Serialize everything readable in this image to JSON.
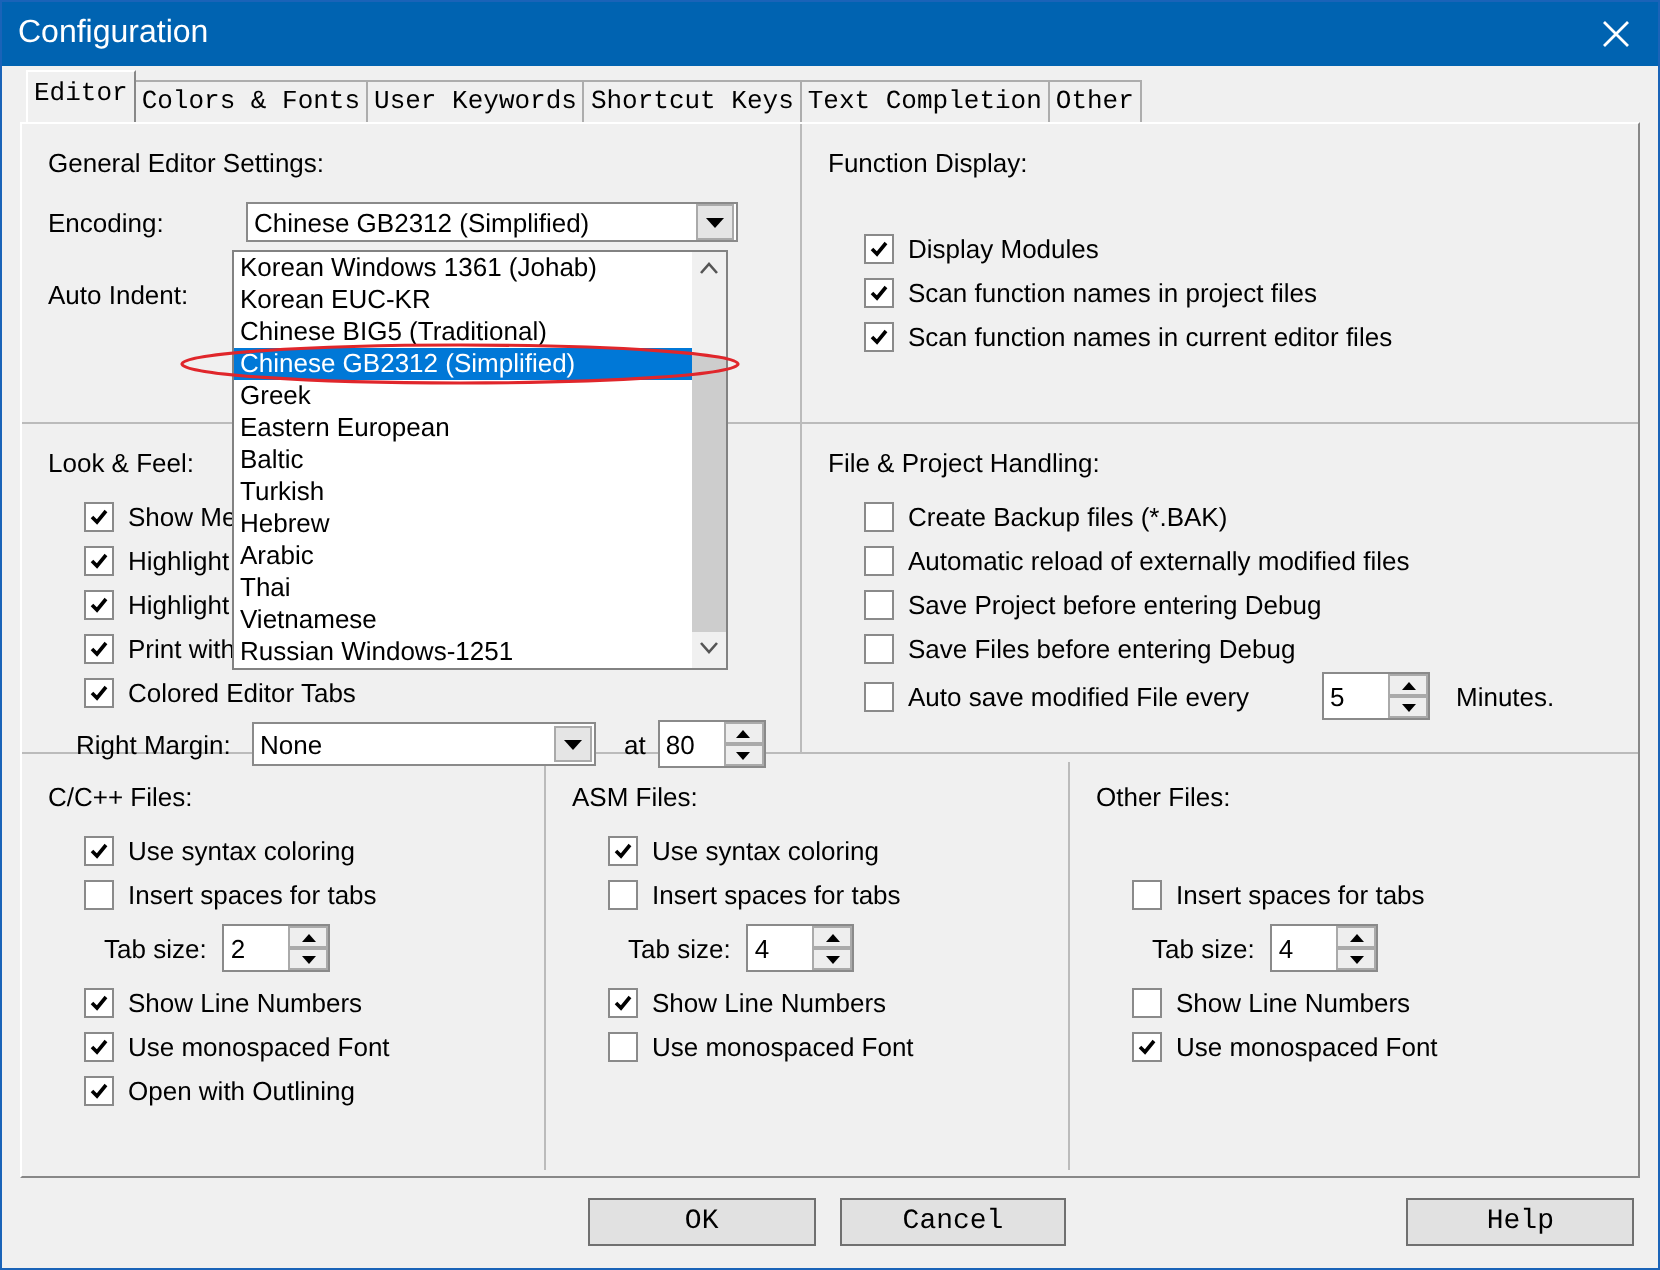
{
  "window": {
    "title": "Configuration"
  },
  "tabs": [
    {
      "label": "Editor",
      "selected": true
    },
    {
      "label": "Colors & Fonts",
      "selected": false
    },
    {
      "label": "User Keywords",
      "selected": false
    },
    {
      "label": "Shortcut Keys",
      "selected": false
    },
    {
      "label": "Text Completion",
      "selected": false
    },
    {
      "label": "Other",
      "selected": false
    }
  ],
  "general": {
    "title": "General Editor Settings:",
    "encoding_label": "Encoding:",
    "encoding_value": "Chinese GB2312 (Simplified)",
    "auto_indent_label": "Auto Indent:",
    "encoding_list": [
      {
        "label": "Korean Windows 1361 (Johab)",
        "selected": false
      },
      {
        "label": "Korean EUC-KR",
        "selected": false
      },
      {
        "label": "Chinese BIG5 (Traditional)",
        "selected": false
      },
      {
        "label": "Chinese GB2312 (Simplified)",
        "selected": true
      },
      {
        "label": "Greek",
        "selected": false
      },
      {
        "label": "Eastern European",
        "selected": false
      },
      {
        "label": "Baltic",
        "selected": false
      },
      {
        "label": "Turkish",
        "selected": false
      },
      {
        "label": "Hebrew",
        "selected": false
      },
      {
        "label": "Arabic",
        "selected": false
      },
      {
        "label": "Thai",
        "selected": false
      },
      {
        "label": "Vietnamese",
        "selected": false
      },
      {
        "label": "Russian Windows-1251",
        "selected": false
      }
    ]
  },
  "function_display": {
    "title": "Function Display:",
    "options": [
      {
        "label": "Display Modules",
        "checked": true
      },
      {
        "label": "Scan function names in project files",
        "checked": true
      },
      {
        "label": "Scan function names in current editor files",
        "checked": true
      }
    ]
  },
  "look_feel": {
    "title": "Look & Feel:",
    "options": [
      {
        "label": "Show Me",
        "checked": true
      },
      {
        "label": "Highlight",
        "checked": true
      },
      {
        "label": "Highlight",
        "checked": true
      },
      {
        "label": "Print with",
        "checked": true
      },
      {
        "label": "Colored Editor Tabs",
        "checked": true
      }
    ],
    "right_margin_label": "Right Margin:",
    "right_margin_value": "None",
    "at_label": "at",
    "at_value": "80"
  },
  "file_handling": {
    "title": "File & Project Handling:",
    "options": [
      {
        "label": "Create Backup files (*.BAK)",
        "checked": false
      },
      {
        "label": "Automatic reload of externally modified files",
        "checked": false
      },
      {
        "label": "Save Project before entering Debug",
        "checked": false
      },
      {
        "label": "Save Files before entering Debug",
        "checked": false
      }
    ],
    "autosave": {
      "label": "Auto save modified File every",
      "checked": false,
      "value": "5",
      "unit": "Minutes."
    }
  },
  "file_groups": [
    {
      "title": "C/C++ Files:",
      "items": [
        {
          "kind": "checkbox",
          "label": "Use syntax coloring",
          "checked": true
        },
        {
          "kind": "checkbox",
          "label": "Insert spaces for tabs",
          "checked": false
        },
        {
          "kind": "spin",
          "label": "Tab size:",
          "value": "2"
        },
        {
          "kind": "checkbox",
          "label": "Show Line Numbers",
          "checked": true
        },
        {
          "kind": "checkbox",
          "label": "Use monospaced Font",
          "checked": true
        },
        {
          "kind": "checkbox",
          "label": "Open with Outlining",
          "checked": true
        }
      ]
    },
    {
      "title": "ASM Files:",
      "items": [
        {
          "kind": "checkbox",
          "label": "Use syntax coloring",
          "checked": true
        },
        {
          "kind": "checkbox",
          "label": "Insert spaces for tabs",
          "checked": false
        },
        {
          "kind": "spin",
          "label": "Tab size:",
          "value": "4"
        },
        {
          "kind": "checkbox",
          "label": "Show Line Numbers",
          "checked": true
        },
        {
          "kind": "checkbox",
          "label": "Use monospaced Font",
          "checked": false
        }
      ]
    },
    {
      "title": "Other Files:",
      "items": [
        {
          "kind": "blank"
        },
        {
          "kind": "checkbox",
          "label": "Insert spaces for tabs",
          "checked": false
        },
        {
          "kind": "spin",
          "label": "Tab size:",
          "value": "4"
        },
        {
          "kind": "checkbox",
          "label": "Show Line Numbers",
          "checked": false
        },
        {
          "kind": "checkbox",
          "label": "Use monospaced Font",
          "checked": true
        }
      ]
    }
  ],
  "buttons": [
    "OK",
    "Cancel",
    "Help"
  ]
}
